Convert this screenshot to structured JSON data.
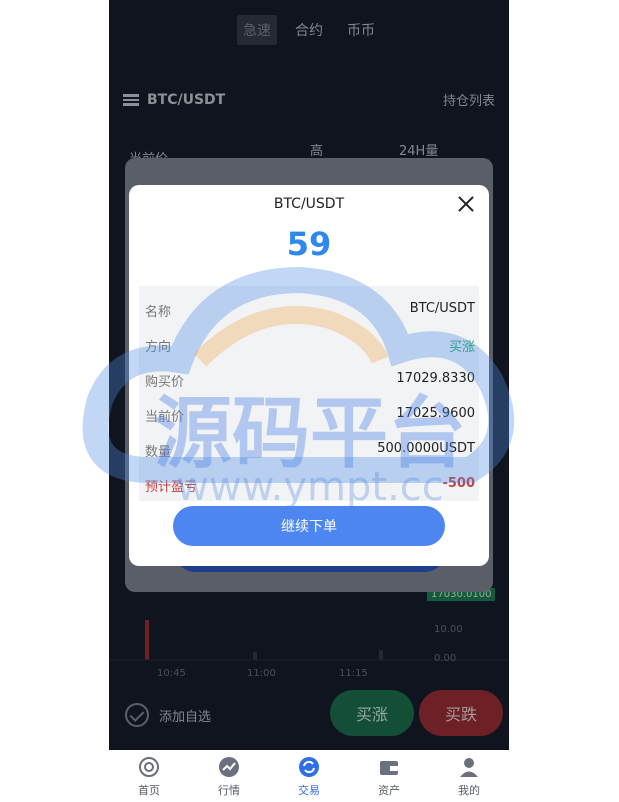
{
  "top_tabs": [
    "急速",
    "合约",
    "币币"
  ],
  "pair": {
    "name": "BTC/USDT",
    "hold_list": "持仓列表"
  },
  "stats": {
    "current_price_label": "当前价",
    "high_label": "高",
    "volume_label": "24H量"
  },
  "chart": {
    "price_tag": "17030.0100",
    "y_labels": [
      "10.00",
      "0.00"
    ],
    "x_labels": [
      "10:45",
      "11:00",
      "11:15"
    ]
  },
  "bottom": {
    "add_fav": "添加自选",
    "buy_up": "买涨",
    "buy_down": "买跌"
  },
  "tabbar": [
    {
      "label": "首页",
      "icon": "home-icon"
    },
    {
      "label": "行情",
      "icon": "trend-icon"
    },
    {
      "label": "交易",
      "icon": "trade-icon"
    },
    {
      "label": "资产",
      "icon": "wallet-icon"
    },
    {
      "label": "我的",
      "icon": "user-icon"
    }
  ],
  "modal": {
    "title": "BTC/USDT",
    "countdown": "59",
    "rows": [
      {
        "key": "名称",
        "value": "BTC/USDT"
      },
      {
        "key": "方向",
        "value": "买涨"
      },
      {
        "key": "购买价",
        "value": "17029.8330"
      },
      {
        "key": "当前价",
        "value": "17025.9600"
      },
      {
        "key": "数量",
        "value": "500.0000USDT"
      },
      {
        "key": "预计盈亏",
        "value": "-500"
      }
    ],
    "continue_label": "继续下单"
  },
  "watermark": {
    "line1": "源码平台",
    "line2": "www.ympt.cc"
  },
  "colors": {
    "accent": "#2d88f0",
    "up": "#1ea865",
    "down": "#c14343",
    "button": "#4d86f0"
  }
}
